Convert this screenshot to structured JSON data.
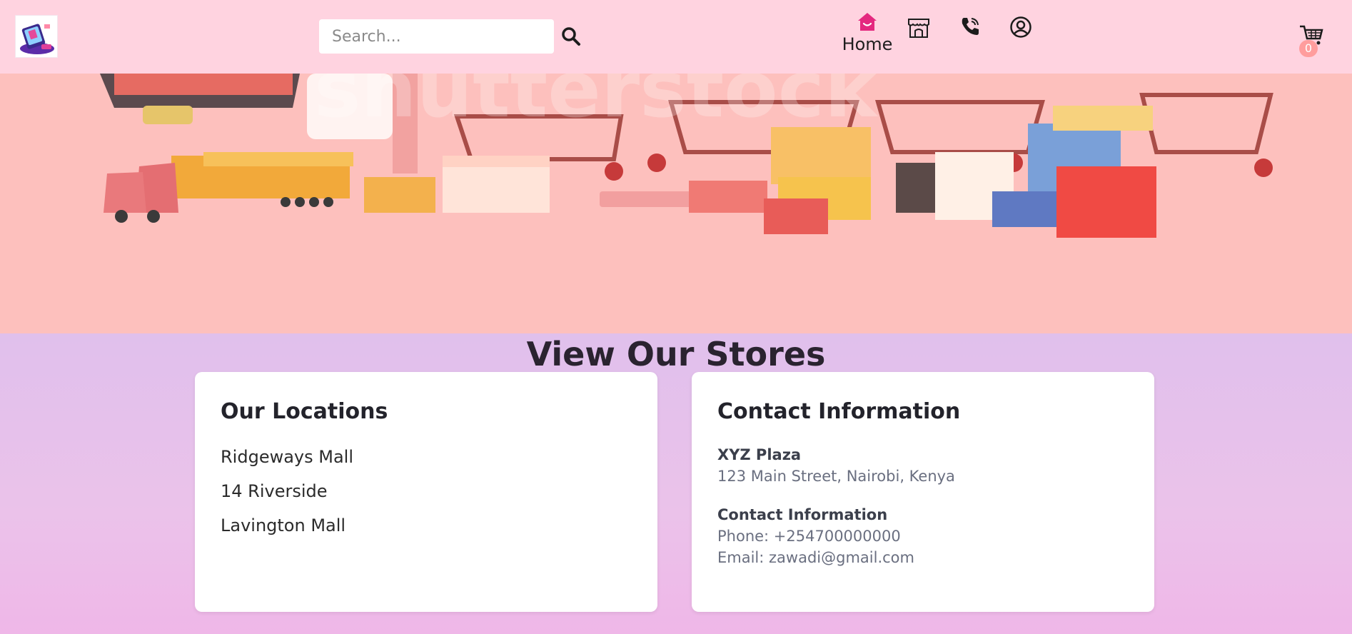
{
  "header": {
    "search_placeholder": "Search...",
    "nav": {
      "home_label": "Home"
    },
    "cart_count": "0",
    "accent_color": "#e4287f"
  },
  "icons": {
    "logo": "shop-logo-phone-illustration",
    "search": "search-icon",
    "home": "home-icon",
    "store": "store-icon",
    "phone": "phone-icon",
    "account": "account-icon",
    "cart": "cart-icon"
  },
  "stores": {
    "title": "View Our Stores",
    "locations": {
      "title": "Our Locations",
      "items": [
        "Ridgeways Mall",
        "14 Riverside",
        "Lavington Mall"
      ]
    },
    "contact": {
      "title": "Contact Information",
      "address_heading": "XYZ Plaza",
      "address": "123 Main Street, Nairobi, Kenya",
      "contact_heading": "Contact Information",
      "phone": "Phone: +254700000000",
      "email": "Email: zawadi@gmail.com"
    }
  }
}
